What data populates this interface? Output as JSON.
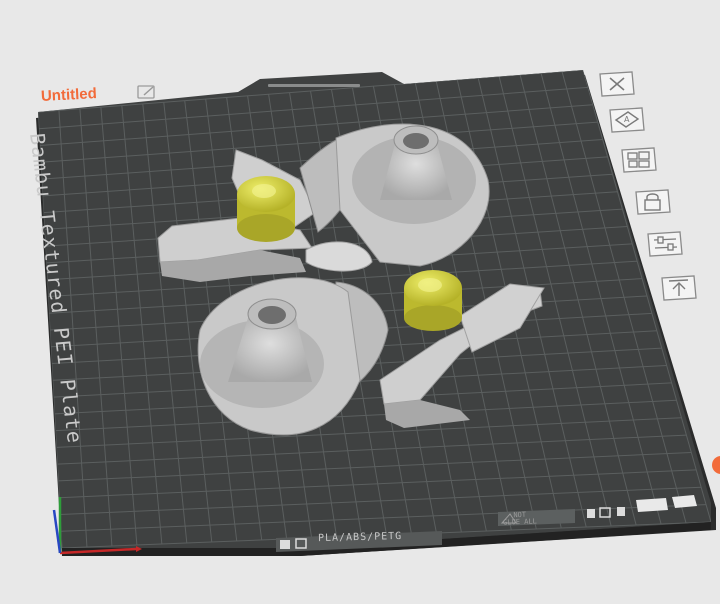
{
  "plate": {
    "title": "Untitled",
    "bed_label": "Bambu Textured PEI Plate",
    "filament_label": "PLA/ABS/PETG",
    "warning_label": "NOT\nGLUE ALL"
  },
  "toolbar": {
    "buttons": [
      {
        "name": "close-plate-button",
        "icon": "close-icon"
      },
      {
        "name": "auto-orient-button",
        "icon": "auto-orient-icon"
      },
      {
        "name": "arrange-button",
        "icon": "arrange-icon"
      },
      {
        "name": "lock-plate-button",
        "icon": "lock-icon"
      },
      {
        "name": "plate-settings-button",
        "icon": "sliders-icon"
      },
      {
        "name": "move-up-button",
        "icon": "upload-icon"
      }
    ]
  },
  "colors": {
    "accent": "#f26b3a",
    "bed": "#3f4141",
    "grid": "#5e6262",
    "model": "#c9c9c9",
    "selected_part": "#d8d63a"
  }
}
